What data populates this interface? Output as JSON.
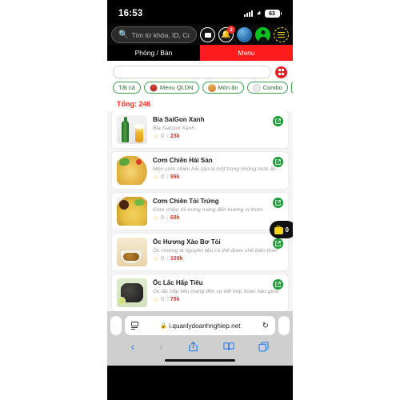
{
  "status_bar": {
    "time": "16:53",
    "battery": "63",
    "signal_icon": "cellular-signal-icon",
    "wifi_icon": "wifi-icon"
  },
  "app_header": {
    "search": {
      "placeholder": "Tìm từ khóa, ID, Code",
      "value": "",
      "icon": "search-icon"
    },
    "icons": [
      {
        "name": "card-icon",
        "label": ""
      },
      {
        "name": "bell-icon",
        "label": "",
        "badge": "2"
      },
      {
        "name": "globe-icon",
        "label": ""
      },
      {
        "name": "avatar-icon",
        "label": ""
      },
      {
        "name": "hamburger-menu-icon",
        "label": ""
      }
    ]
  },
  "tabs": [
    {
      "label": "Phòng / Bàn",
      "active": false
    },
    {
      "label": "Menu",
      "active": true
    }
  ],
  "toolbar": {
    "search_value": "",
    "search_placeholder": "",
    "qr_icon": "qr-scan-icon"
  },
  "filters": [
    {
      "label": "Tất cả",
      "icon": ""
    },
    {
      "label": "Menu QLDN",
      "icon": "qldn-logo-icon"
    },
    {
      "label": "Món ăn",
      "icon": "food-icon"
    },
    {
      "label": "Combo",
      "icon": "combo-icon"
    }
  ],
  "total_label": "Tổng: 246",
  "items": [
    {
      "title": "Bia SaiGon Xanh",
      "description": "Bia SaiGon Xanh",
      "rating": "0",
      "separator": "|",
      "price": "23k",
      "thumb": "beer-bottle-glass-image",
      "edit_icon": "external-link-icon"
    },
    {
      "title": "Cơm Chiên Hải Sản",
      "description": "Món cơm chiên hải sản là một trong những món ăn",
      "rating": "0",
      "separator": "|",
      "price": "99k",
      "thumb": "seafood-fried-rice-image",
      "edit_icon": "external-link-icon"
    },
    {
      "title": "Cơm Chiên Tỏi Trứng",
      "description": "Cơm chiên tỏi trứng mang đến hương vị thơm",
      "rating": "0",
      "separator": "|",
      "price": "69k",
      "thumb": "garlic-egg-fried-rice-image",
      "edit_icon": "external-link-icon"
    },
    {
      "title": "Ốc Hương Xào Bơ Tỏi",
      "description": "Ốc Hương là nguyên liệu có thể được chế biến thàn",
      "rating": "0",
      "separator": "|",
      "price": "109k",
      "thumb": "garlic-butter-snail-image",
      "edit_icon": "external-link-icon"
    },
    {
      "title": "Ốc Lắc Hấp Tiêu",
      "description": "Ốc lắc hấp tiêu mang đến sự kết hợp hoàn hảo giữa",
      "rating": "0",
      "separator": "|",
      "price": "79k",
      "thumb": "pepper-steamed-snail-image",
      "edit_icon": "external-link-icon"
    }
  ],
  "cart_fab": {
    "count": "0",
    "icon": "shopping-bag-icon"
  },
  "browser": {
    "reader_icon": "reader-view-icon",
    "lock_icon": "lock-icon",
    "url": "i.quanlydoanhnghiep.net",
    "reload_icon": "reload-icon",
    "nav": [
      {
        "name": "back-button",
        "glyph": "‹",
        "enabled": true
      },
      {
        "name": "forward-button",
        "glyph": "›",
        "enabled": false
      },
      {
        "name": "share-button",
        "glyph": "share-icon",
        "enabled": true
      },
      {
        "name": "bookmarks-button",
        "glyph": "book-icon",
        "enabled": true
      },
      {
        "name": "tabs-button",
        "glyph": "tabs-icon",
        "enabled": true
      }
    ]
  },
  "colors": {
    "accent_red": "#fd1c1c",
    "price_red": "#ff2a21",
    "green": "#1a9c36",
    "chip_border": "#3a9e4e",
    "yellow": "#f5d71a"
  }
}
